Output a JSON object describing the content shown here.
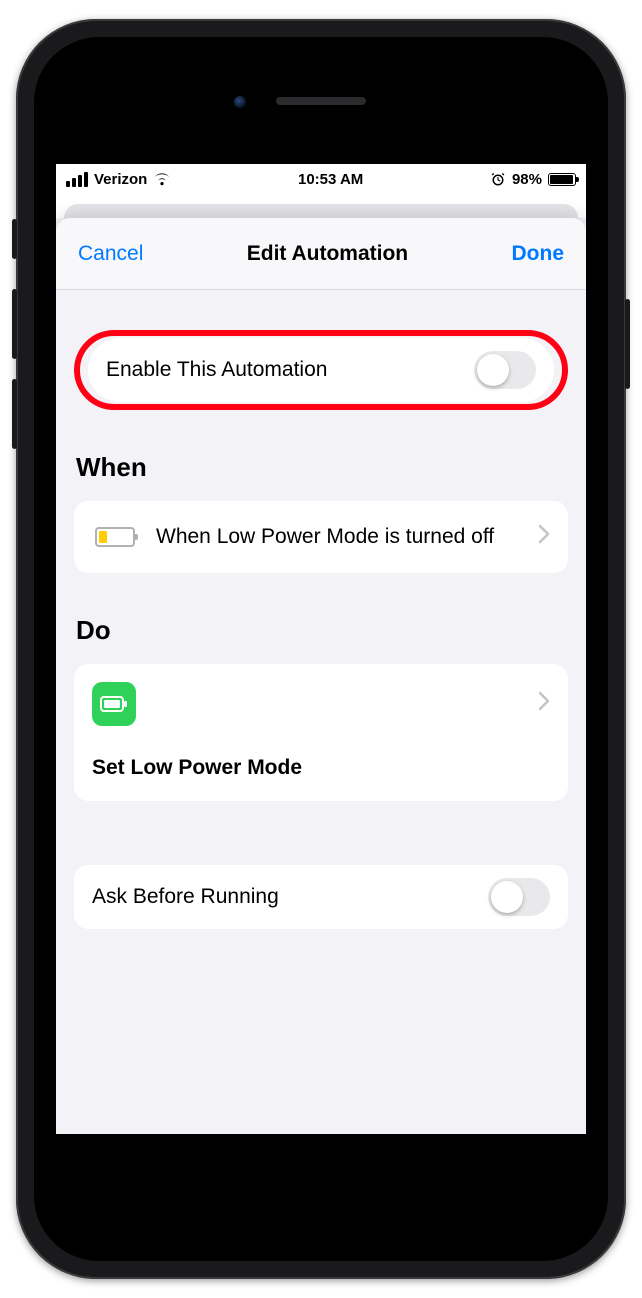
{
  "status": {
    "carrier": "Verizon",
    "time": "10:53 AM",
    "battery_pct": "98%"
  },
  "header": {
    "cancel": "Cancel",
    "title": "Edit Automation",
    "done": "Done"
  },
  "enable_row": {
    "label": "Enable This Automation",
    "on": false
  },
  "sections": {
    "when_title": "When",
    "do_title": "Do"
  },
  "when": {
    "text": "When Low Power Mode is turned off"
  },
  "do": {
    "text": "Set Low Power Mode"
  },
  "ask_row": {
    "label": "Ask Before Running",
    "on": false
  }
}
